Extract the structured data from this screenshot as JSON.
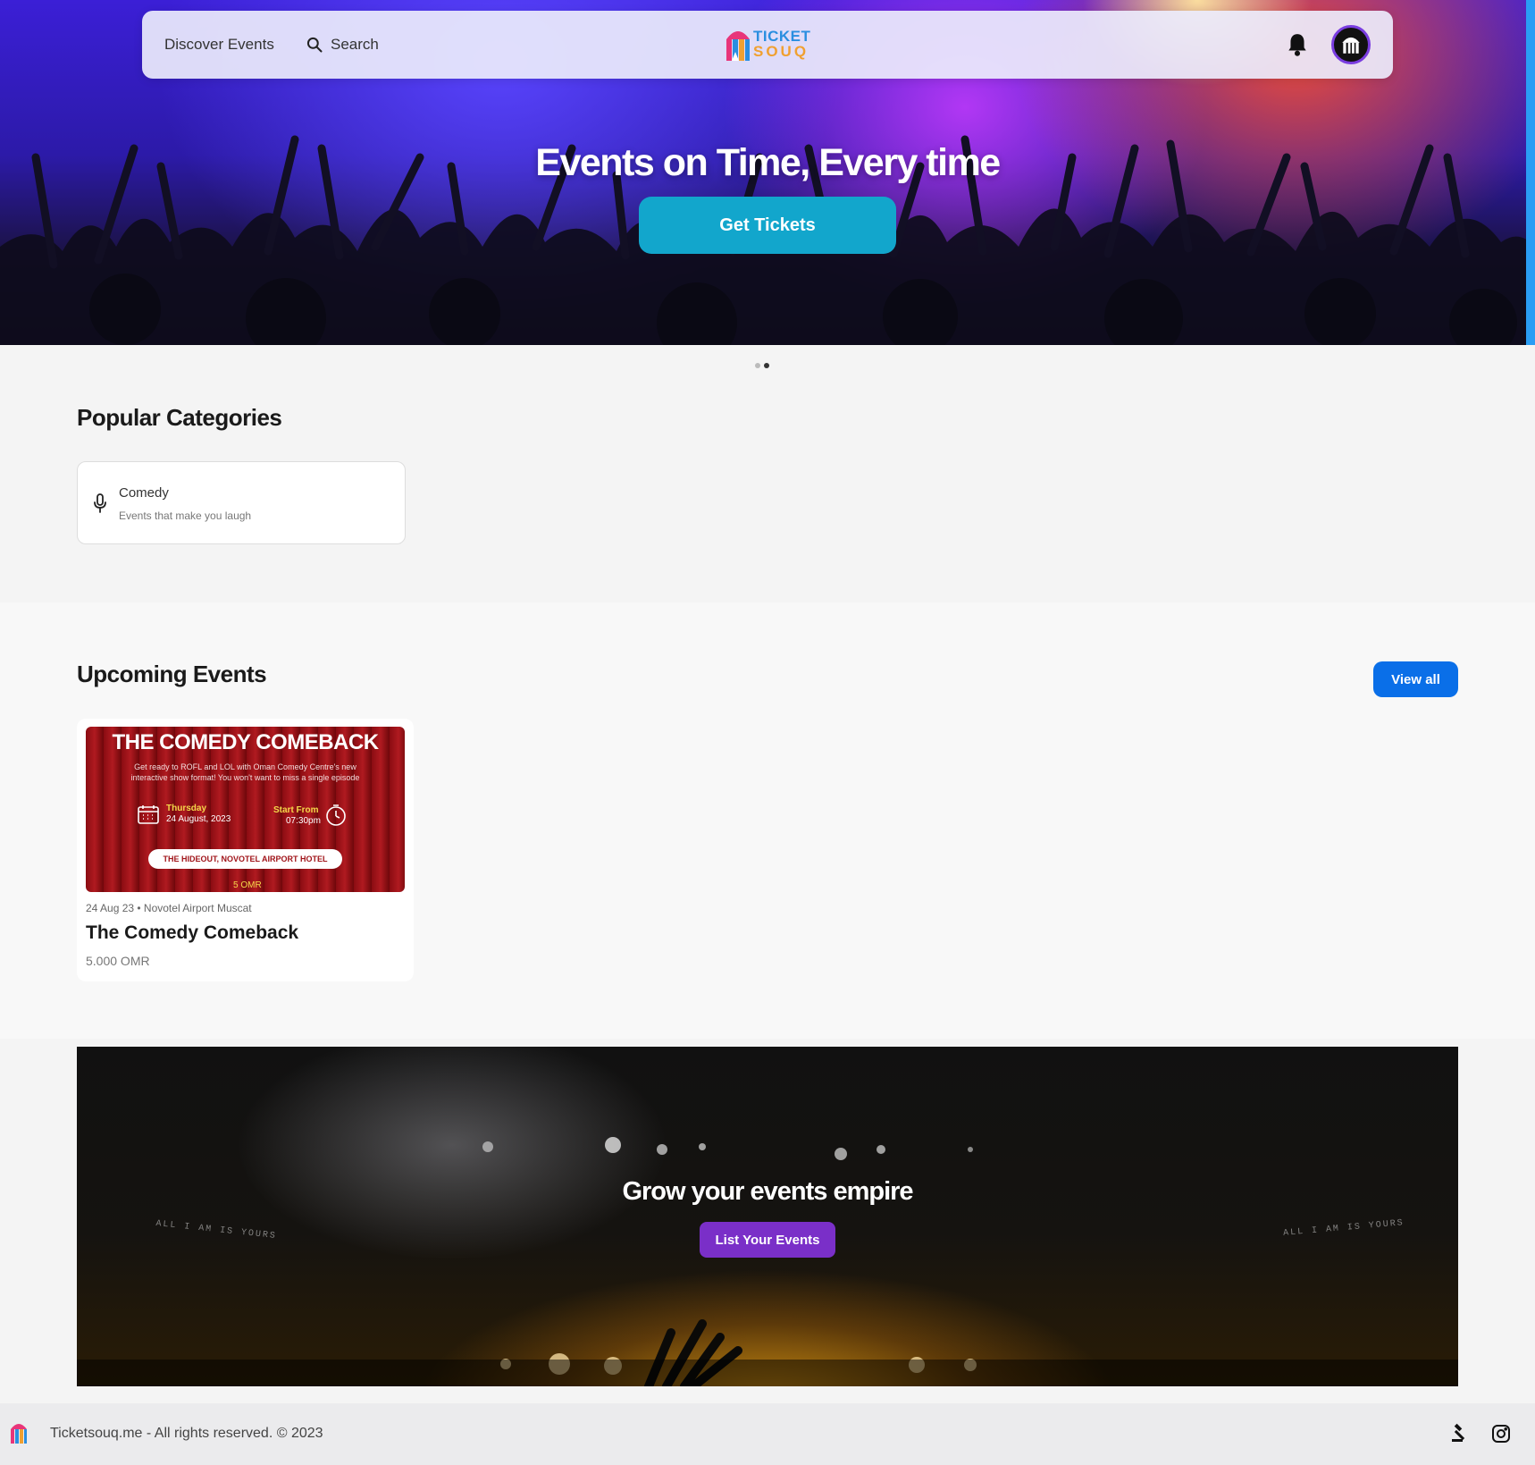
{
  "nav": {
    "discover": "Discover Events",
    "search": "Search",
    "logo_line1": "TICKET",
    "logo_line2": "SOUQ"
  },
  "hero": {
    "title": "Events on Time, Every time",
    "button": "Get Tickets",
    "slides": 2,
    "active_slide": 2
  },
  "categories": {
    "title": "Popular Categories",
    "items": [
      {
        "name": "Comedy",
        "description": "Events that make you laugh",
        "icon": "microphone-icon"
      }
    ]
  },
  "upcoming": {
    "title": "Upcoming Events",
    "view_all": "View all",
    "events": [
      {
        "poster": {
          "title": "THE COMEDY COMEBACK",
          "blurb": "Get ready to ROFL and LOL with Oman Comedy Centre's new interactive show format! You won't want to miss a single episode",
          "day": "Thursday",
          "date": "24 August, 2023",
          "start_label": "Start From",
          "start_time": "07:30pm",
          "venue": "THE HIDEOUT, NOVOTEL AIRPORT HOTEL",
          "price": "5 OMR"
        },
        "meta": "24 Aug 23 • Novotel Airport Muscat",
        "name": "The Comedy Comeback",
        "price": "5.000 OMR"
      }
    ]
  },
  "cta": {
    "title": "Grow your events empire",
    "button": "List Your Events",
    "side_text": "ALL I AM IS YOURS"
  },
  "footer": {
    "copyright": "Ticketsouq.me - All rights reserved. © 2023",
    "icons": [
      "gavel-icon",
      "instagram-icon"
    ]
  },
  "colors": {
    "hero_button": "#12a6cc",
    "view_all_button": "#0a6fe8",
    "cta_button": "#7a2fc8",
    "logo_blue": "#2a8ee0",
    "logo_orange": "#f0a030"
  }
}
